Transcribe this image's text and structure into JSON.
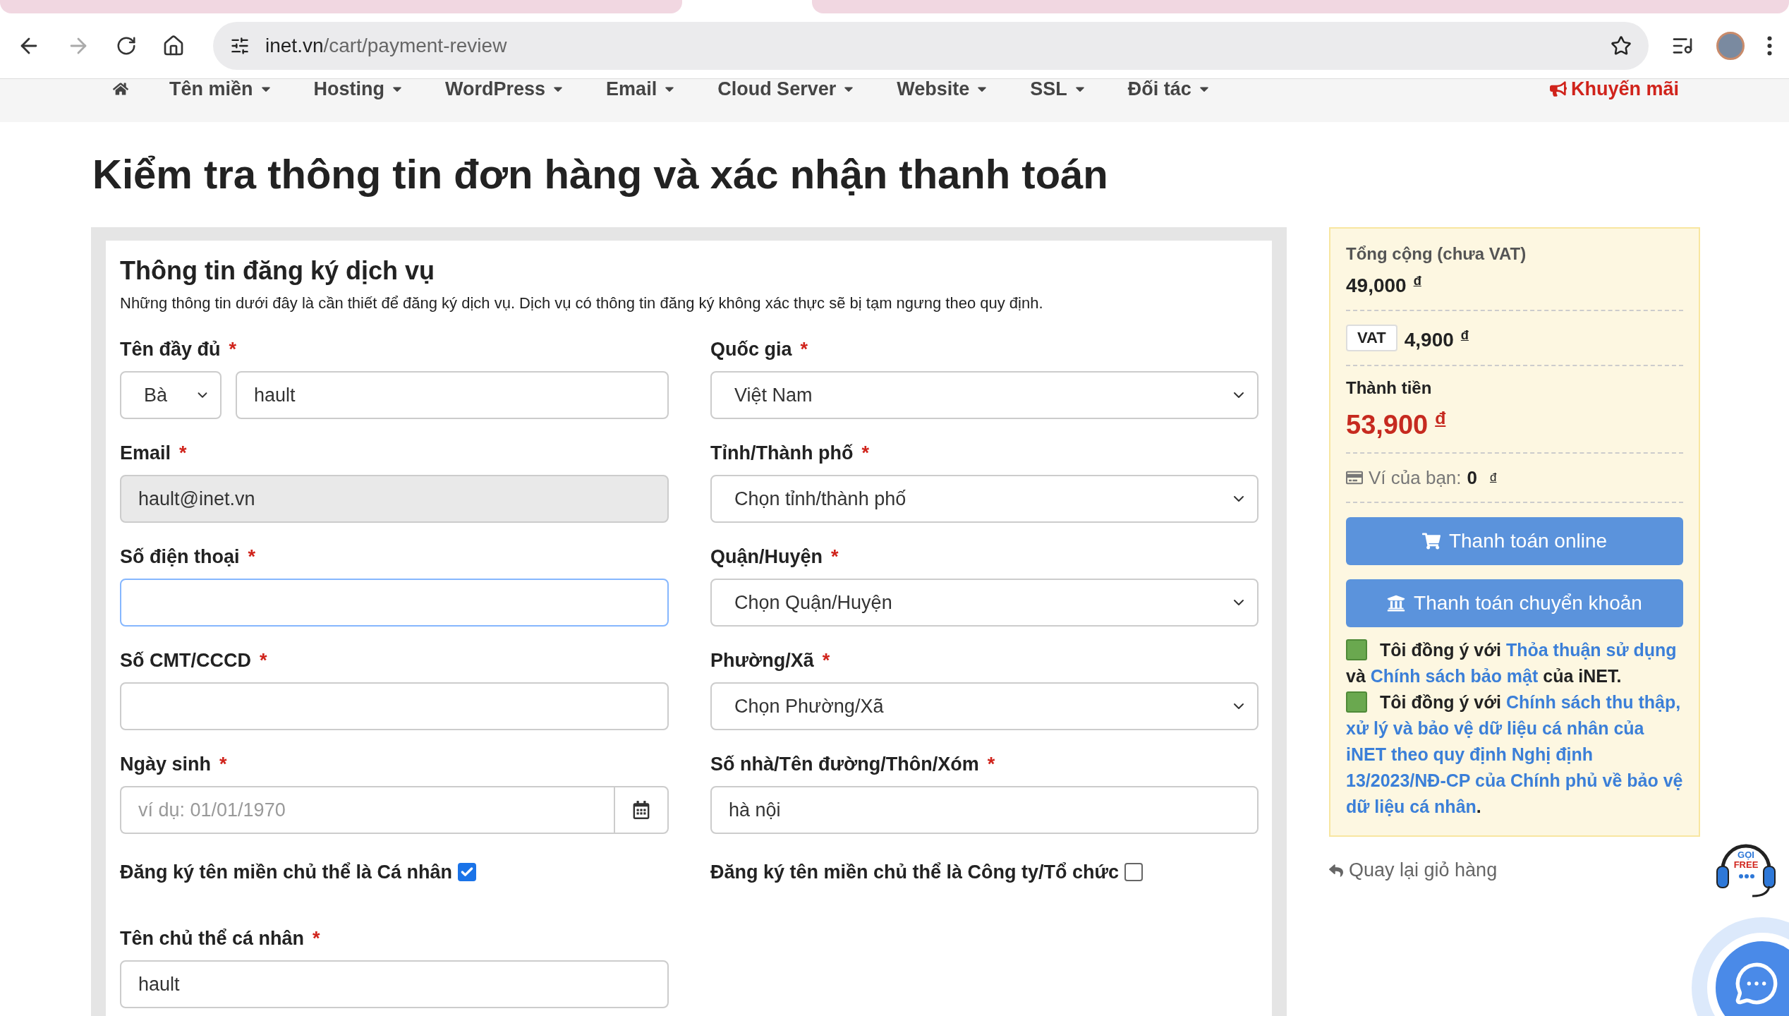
{
  "browser": {
    "url_host": "inet.vn",
    "url_path": "/cart/payment-review"
  },
  "nav": {
    "items": [
      {
        "label": "Tên miền"
      },
      {
        "label": "Hosting"
      },
      {
        "label": "WordPress"
      },
      {
        "label": "Email"
      },
      {
        "label": "Cloud Server"
      },
      {
        "label": "Website"
      },
      {
        "label": "SSL"
      },
      {
        "label": "Đối tác"
      }
    ],
    "promo": "Khuyến mãi"
  },
  "page_title": "Kiểm tra thông tin đơn hàng và xác nhận thanh toán",
  "form": {
    "title": "Thông tin đăng ký dịch vụ",
    "description": "Những thông tin dưới đây là cần thiết để đăng ký dịch vụ. Dịch vụ có thông tin đăng ký không xác thực sẽ bị tạm ngưng theo quy định.",
    "rows": [
      {
        "left": {
          "kind": "name",
          "label": "Tên đầy đủ",
          "mark": "*",
          "salutation": "Bà",
          "value": "hault",
          "disabled": false,
          "focused": false
        },
        "right": {
          "kind": "select",
          "label": "Quốc gia",
          "mark": "*",
          "value": "Việt Nam"
        }
      },
      {
        "left": {
          "kind": "input",
          "label": "Email",
          "mark": "*",
          "value": "hault@inet.vn",
          "disabled": true,
          "focused": false
        },
        "right": {
          "kind": "select",
          "label": "Tỉnh/Thành phố",
          "mark": "*",
          "value": "Chọn tỉnh/thành phố"
        }
      },
      {
        "left": {
          "kind": "input",
          "label": "Số điện thoại",
          "mark": "*",
          "disabled": false,
          "focused": true
        },
        "right": {
          "kind": "select",
          "label": "Quận/Huyện",
          "mark": "*",
          "value": "Chọn Quận/Huyện"
        }
      },
      {
        "left": {
          "kind": "input",
          "label": "Số CMT/CCCD",
          "mark": "*",
          "disabled": false,
          "focused": false
        },
        "right": {
          "kind": "select",
          "label": "Phường/Xã",
          "mark": "*",
          "value": "Chọn Phường/Xã"
        }
      },
      {
        "left": {
          "kind": "date",
          "label": "Ngày sinh",
          "mark": "*",
          "placeholder": "ví dụ: 01/01/1970"
        },
        "right": {
          "kind": "input",
          "label": "Số nhà/Tên đường/Thôn/Xóm",
          "mark": "*",
          "value": "hà nội",
          "disabled": false,
          "focused": false
        }
      },
      {
        "left": {
          "kind": "checkbox",
          "label": "Đăng ký tên miền chủ thể là Cá nhân",
          "checked": true
        },
        "right": {
          "kind": "checkbox",
          "label": "Đăng ký tên miền chủ thể là Công ty/Tổ chức",
          "checked": false
        }
      },
      {
        "left": {
          "kind": "input",
          "label": "Tên chủ thể cá nhân",
          "mark": "*",
          "value": "hault",
          "disabled": false,
          "focused": false
        }
      }
    ]
  },
  "summary": {
    "subtotal_label": "Tổng cộng (chưa VAT)",
    "subtotal": "49,000",
    "subtotal_currency": "đ",
    "vat_label": "VAT",
    "vat": "4,900",
    "vat_currency": "đ",
    "total_label": "Thành tiền",
    "total": "53,900",
    "total_currency": "đ",
    "wallet_label": "Ví của bạn:",
    "wallet": "0",
    "wallet_currency": "đ",
    "buttons": [
      {
        "kind": "cart",
        "label": "Thanh toán online"
      },
      {
        "kind": "bank",
        "label": "Thanh toán chuyển khoản"
      }
    ],
    "consents": [
      {
        "checked": true,
        "parts": [
          {
            "text": "Tôi đồng ý với ",
            "link": false
          },
          {
            "text": "Thỏa thuận sử dụng",
            "link": true
          },
          {
            "text": " và ",
            "link": false
          },
          {
            "text": "Chính sách bảo mật",
            "link": true
          },
          {
            "text": " của iNET.",
            "link": false
          }
        ]
      },
      {
        "checked": true,
        "parts": [
          {
            "text": "Tôi đồng ý với ",
            "link": false
          },
          {
            "text": "Chính sách thu thập, xử lý và bảo vệ dữ liệu cá nhân của iNET theo quy định Nghị định 13/2023/NĐ-CP của Chính phủ về bảo vệ dữ liệu cá nhân",
            "link": true
          },
          {
            "text": ".",
            "link": false
          }
        ]
      }
    ]
  },
  "back_link": "Quay lại giỏ hàng",
  "call_widget": {
    "line1": "GỌI",
    "line2": "FREE"
  }
}
